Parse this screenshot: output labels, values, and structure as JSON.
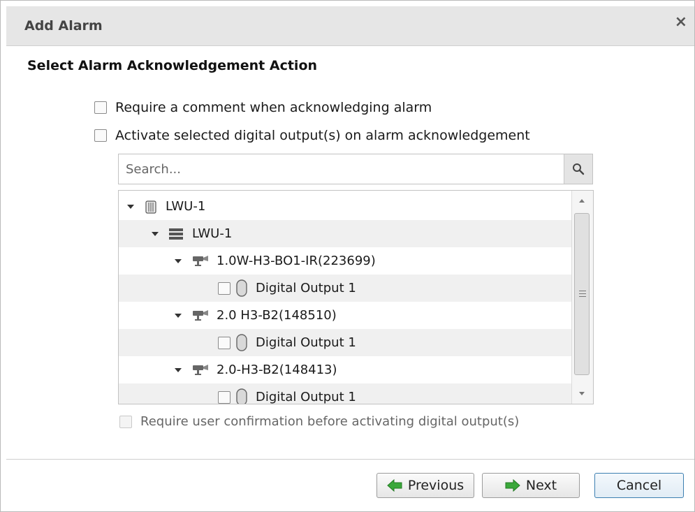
{
  "dialog": {
    "title": "Add Alarm",
    "close_label": "×"
  },
  "section": {
    "heading": "Select Alarm Acknowledgement Action"
  },
  "options": {
    "require_comment": {
      "label": "Require a comment when acknowledging alarm",
      "checked": false
    },
    "activate_outputs": {
      "label": "Activate selected digital output(s) on alarm acknowledgement",
      "checked": false
    }
  },
  "search": {
    "placeholder": "Search...",
    "value": ""
  },
  "tree": {
    "items": [
      {
        "label": "LWU-1",
        "kind": "site",
        "expanded": true
      },
      {
        "label": "LWU-1",
        "kind": "server",
        "expanded": true
      },
      {
        "label": "1.0W-H3-BO1-IR(223699)",
        "kind": "camera",
        "expanded": true
      },
      {
        "label": "Digital Output 1",
        "kind": "digital-output",
        "checked": false
      },
      {
        "label": "2.0 H3-B2(148510)",
        "kind": "camera",
        "expanded": true
      },
      {
        "label": "Digital Output 1",
        "kind": "digital-output",
        "checked": false
      },
      {
        "label": "2.0-H3-B2(148413)",
        "kind": "camera",
        "expanded": true
      },
      {
        "label": "Digital Output 1",
        "kind": "digital-output",
        "checked": false
      }
    ]
  },
  "confirm": {
    "label": "Require user confirmation before activating digital output(s)",
    "checked": false,
    "disabled": true
  },
  "buttons": {
    "previous": "Previous",
    "next": "Next",
    "cancel": "Cancel"
  },
  "colors": {
    "arrow_green": "#3aa83a",
    "cancel_border": "#3c7fb1"
  }
}
